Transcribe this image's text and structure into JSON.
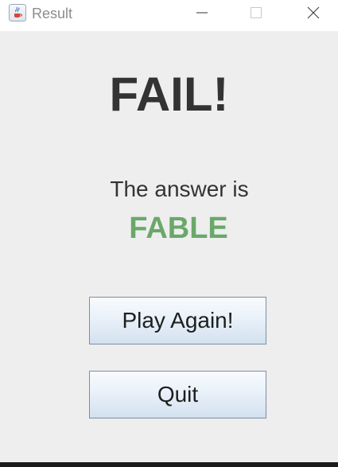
{
  "window": {
    "title": "Result",
    "icon": "java-cup-icon",
    "controls": [
      "minimize-icon",
      "maximize-icon",
      "close-icon"
    ]
  },
  "result": {
    "headline": "FAIL!",
    "answer_label": "The answer is",
    "answer_word": "FABLE"
  },
  "buttons": {
    "play_again": "Play Again!",
    "quit": "Quit"
  },
  "colors": {
    "background": "#eeeeee",
    "headline": "#333333",
    "answer_word": "#6aa86a"
  }
}
